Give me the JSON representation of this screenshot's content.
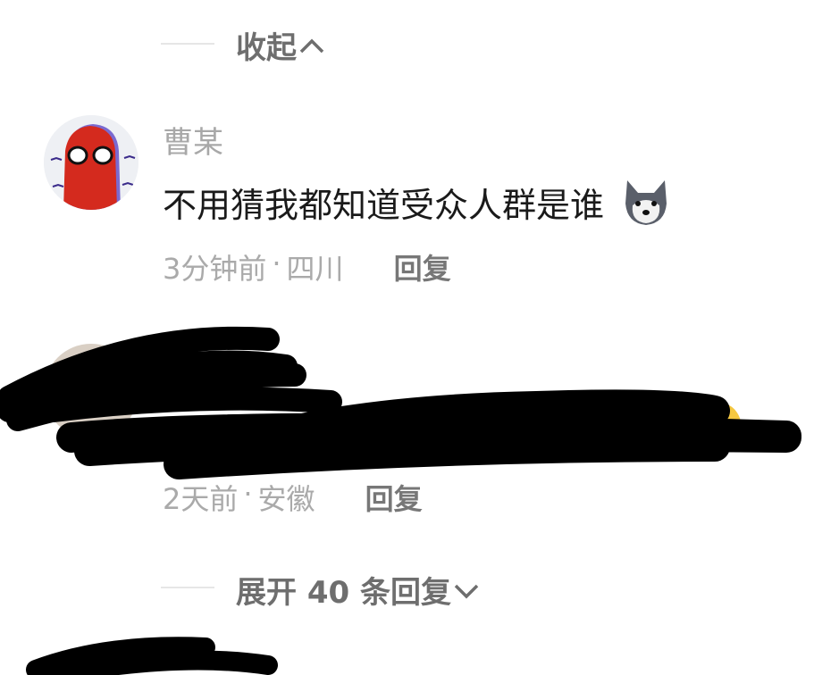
{
  "collapse": {
    "label": "收起",
    "icon": "chevron-up-icon"
  },
  "comments": [
    {
      "author": "曹某",
      "text": "不用猜我都知道受众人群是谁",
      "emoji": "husky-dog-emoji",
      "time": "3分钟前",
      "location": "四川",
      "reply_label": "回复"
    },
    {
      "author": "",
      "text": "",
      "emoji": "smiley-emoji",
      "time": "2天前",
      "location": "安徽",
      "reply_label": "回复",
      "redacted": true
    }
  ],
  "expand": {
    "label": "展开 40 条回复",
    "icon": "chevron-down-icon"
  },
  "separator": "·"
}
